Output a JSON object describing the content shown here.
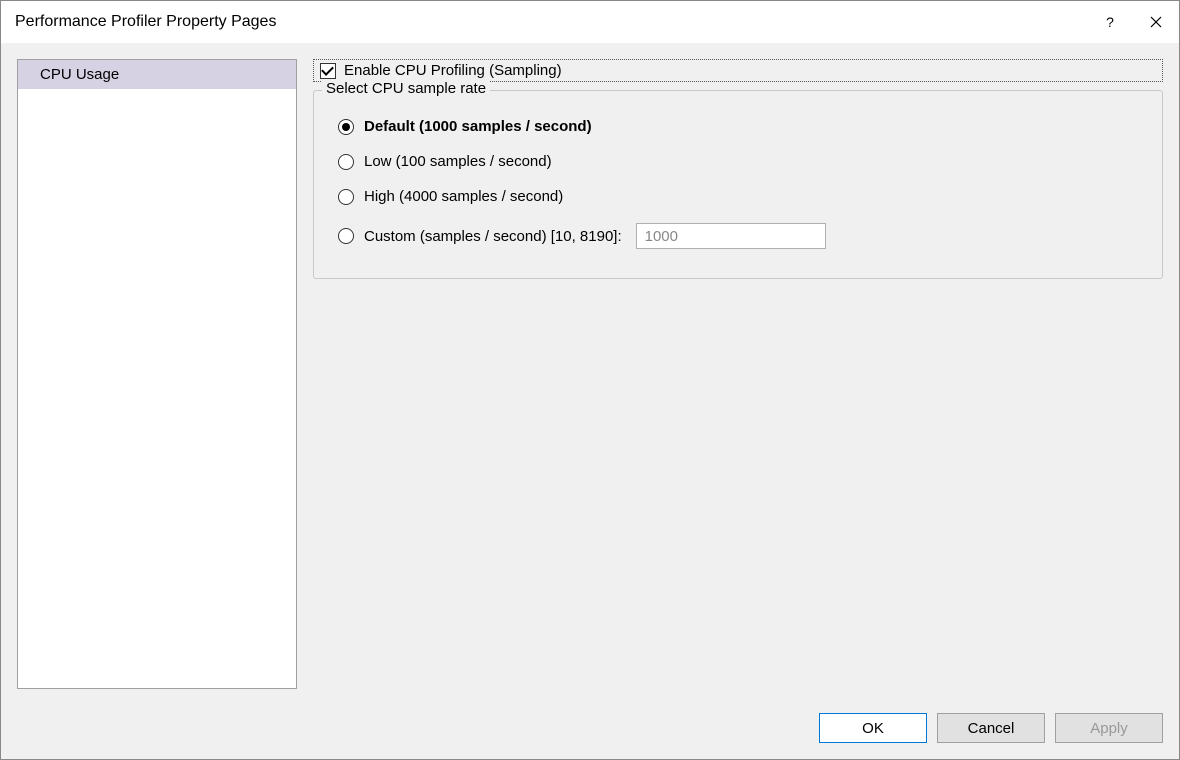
{
  "window": {
    "title": "Performance Profiler Property Pages"
  },
  "sidebar": {
    "items": [
      {
        "label": "CPU Usage",
        "selected": true
      }
    ]
  },
  "main": {
    "enable_checkbox": {
      "label": "Enable CPU Profiling (Sampling)",
      "checked": true
    },
    "sample_rate_group": {
      "legend": "Select CPU sample rate",
      "options": [
        {
          "id": "default",
          "label": "Default (1000 samples / second)",
          "selected": true
        },
        {
          "id": "low",
          "label": "Low (100 samples / second)",
          "selected": false
        },
        {
          "id": "high",
          "label": "High (4000 samples / second)",
          "selected": false
        },
        {
          "id": "custom",
          "label": "Custom (samples / second) [10, 8190]:",
          "selected": false
        }
      ],
      "custom_value": "1000"
    }
  },
  "buttons": {
    "ok": "OK",
    "cancel": "Cancel",
    "apply": "Apply"
  }
}
